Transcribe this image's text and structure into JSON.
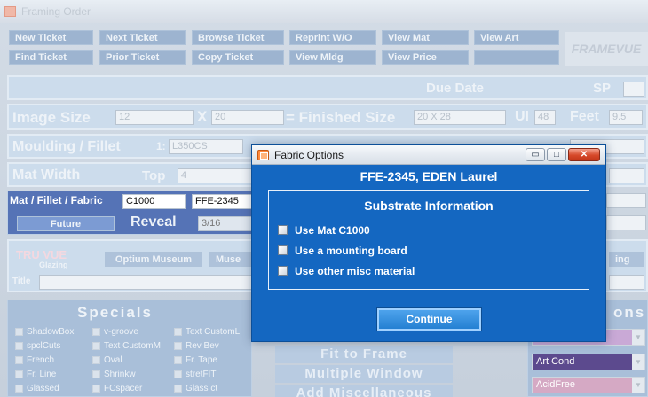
{
  "app": {
    "title": "Framing Order",
    "logo_text": "FRAMEVUE",
    "nav_row1": [
      "New Ticket",
      "Next Ticket",
      "Browse Ticket",
      "Reprint W/O",
      "View Mat",
      "View Art"
    ],
    "nav_row2": [
      "Find Ticket",
      "Prior Ticket",
      "Copy Ticket",
      "View Mldg",
      "View Price"
    ],
    "due_date_label": "Due Date",
    "sp_label": "SP",
    "image_size_label": "Image Size",
    "image_width": "12",
    "x_label": "X",
    "image_height": "20",
    "finished_size_label": "= Finished Size",
    "finished_size_value": "20 X 28",
    "ui_label": "UI",
    "ui_value": "48",
    "feet_label": "Feet",
    "feet_value": "9.5",
    "moulding_label": "Moulding / Fillet",
    "moulding_index": "1:",
    "moulding_value": "L350CS",
    "mat_width_label": "Mat Width",
    "top_label": "Top",
    "top_value": "4",
    "mat_fillet_fabric_label": "Mat / Fillet / Fabric",
    "mat_code": "C1000",
    "fabric_code": "FFE-2345",
    "future_label": "Future",
    "reveal_label": "Reveal",
    "reveal_value": "3/16",
    "truvue_label": "TRU VUE",
    "glazing_label": "Glazing",
    "optium_label": "Optium Museum",
    "museum_partial": "Muse",
    "matting_partial": "ing",
    "title_label": "Title",
    "specials_label": "Specials",
    "options_partial": "ons",
    "specials_col1": [
      "ShadowBox",
      "spclCuts",
      "French",
      "Fr. Line",
      "Glassed"
    ],
    "specials_col2": [
      "v-groove",
      "Text CustomM",
      "Oval",
      "Shrinkw",
      "FCspacer"
    ],
    "specials_col3": [
      "Text CustomL",
      "Rev Bev",
      "Fr. Tape",
      "stretFIT",
      "Glass ct"
    ],
    "fit_to_frame": "Fit to Frame",
    "multiple_window": "Multiple Window",
    "add_misc": "Add Miscellaneous",
    "art_cond": "Art Cond",
    "acid_free": "AcidFree"
  },
  "dialog": {
    "title": "Fabric Options",
    "heading": "FFE-2345, EDEN Laurel",
    "substrate_title": "Substrate Information",
    "options": [
      "Use Mat C1000",
      "Use a mounting board",
      "Use other misc material"
    ],
    "continue_label": "Continue",
    "minimize_glyph": "▭",
    "maximize_glyph": "□",
    "close_glyph": "✕"
  },
  "colors": {
    "dialog_bg": "#1467c1",
    "continue_bg": "#2f8be0",
    "close_red": "#d6492a"
  }
}
